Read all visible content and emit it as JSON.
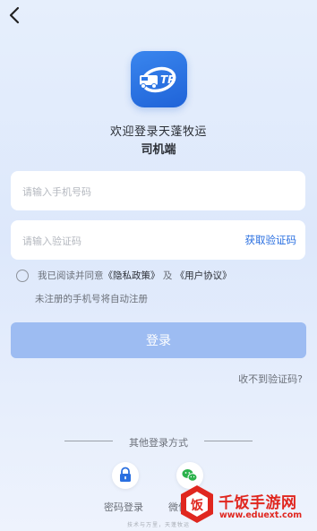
{
  "header": {
    "back_icon": "chevron-left-icon"
  },
  "brand": {
    "logo_text": "TP",
    "welcome": "欢迎登录天蓬牧运",
    "subtitle": "司机端"
  },
  "form": {
    "phone_placeholder": "请输入手机号码",
    "phone_value": "",
    "code_placeholder": "请输入验证码",
    "code_value": "",
    "get_code_label": "获取验证码"
  },
  "agreement": {
    "checked": false,
    "prefix": "我已阅读并同意",
    "privacy_link": "《隐私政策》",
    "and": "及",
    "terms_link": "《用户协议》",
    "hint": "未注册的手机号将自动注册"
  },
  "login_button": "登录",
  "no_code_link": "收不到验证码?",
  "other_login": {
    "title": "其他登录方式",
    "options": [
      {
        "label": "密码登录",
        "icon": "lock-icon",
        "color": "#2a6fe0"
      },
      {
        "label": "微信登录",
        "icon": "wechat-icon",
        "color": "#2bb24c"
      }
    ]
  },
  "slogan": "技术与万里，天蓬牧运",
  "watermark": {
    "title": "千饭手游网",
    "url": "www.eduext.com",
    "color": "#e0271f"
  },
  "colors": {
    "accent": "#2a6fe0",
    "button_disabled": "#9dbcf2"
  }
}
